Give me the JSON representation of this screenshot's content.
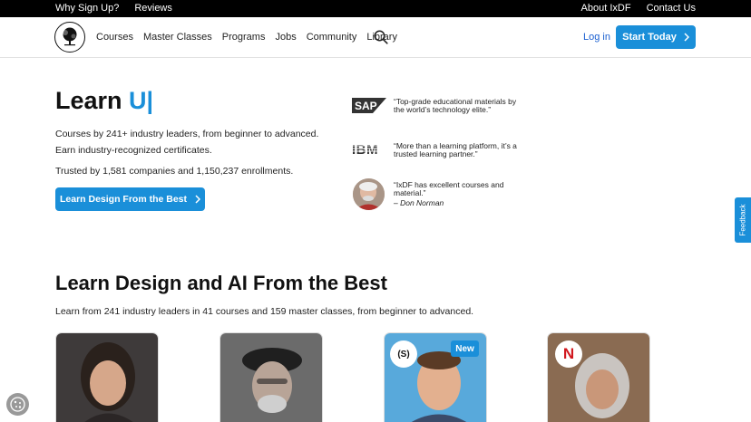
{
  "topbar": {
    "left": [
      "Why Sign Up?",
      "Reviews"
    ],
    "right": [
      "About IxDF",
      "Contact Us"
    ]
  },
  "nav": {
    "logo_icon": "ixdf-tree-logo",
    "items": [
      "Courses",
      "Master Classes",
      "Programs",
      "Jobs",
      "Community",
      "Library"
    ],
    "search_icon": "search-icon",
    "login": "Log in",
    "start": "Start Today"
  },
  "hero": {
    "title_prefix": "Learn",
    "title_typed": "U|",
    "line1": "Courses by 241+ industry leaders, from beginner to advanced.",
    "line2": "Earn industry-recognized certificates.",
    "line3": "Trusted by 1,581 companies and 1,150,237 enrollments.",
    "cta": "Learn Design From the Best"
  },
  "testimonials": [
    {
      "brand": "SAP",
      "quote": "“Top-grade educational materials by the world’s technology elite.”"
    },
    {
      "brand": "IBM",
      "quote": "“More than a learning platform, it’s a trusted learning partner.”"
    },
    {
      "brand": "",
      "quote": "“IxDF has excellent courses and material.”",
      "by": "– Don Norman"
    }
  ],
  "section": {
    "title": "Learn Design and AI From the Best",
    "subtitle": "Learn from 241 industry leaders in 41 courses and 159 master classes, from beginner to advanced."
  },
  "cards": {
    "badge_new": "New",
    "chip_s": "(S)",
    "chip_n": "N"
  },
  "feedback": "Feedback",
  "colors": {
    "accent": "#1a8fd9",
    "topbar": "#000000"
  }
}
